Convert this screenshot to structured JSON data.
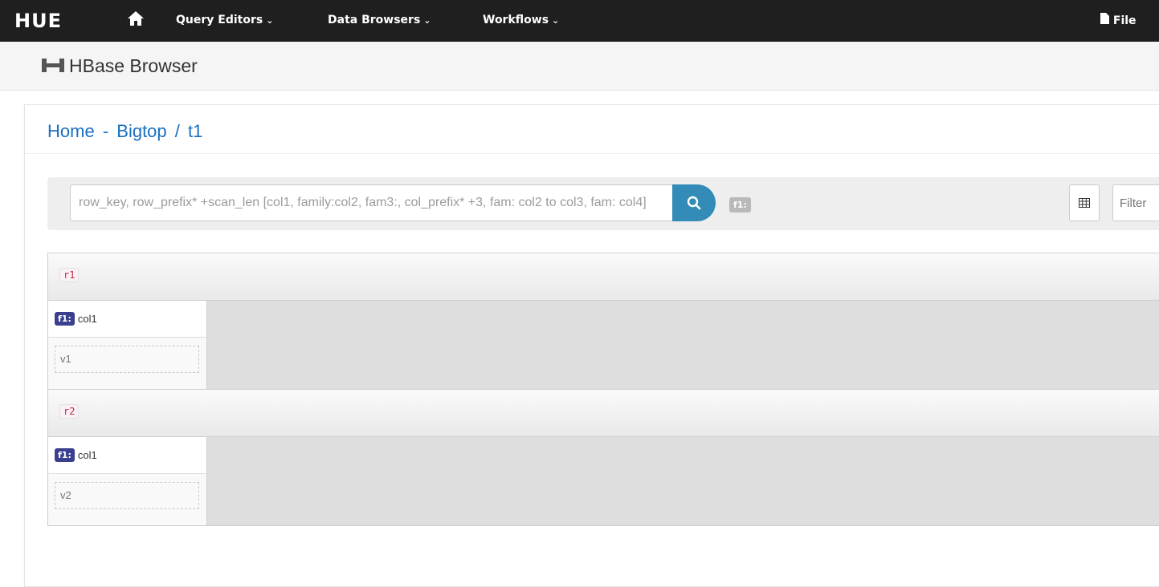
{
  "nav": {
    "logo": "HUE",
    "items": [
      {
        "label": "Query Editors"
      },
      {
        "label": "Data Browsers"
      },
      {
        "label": "Workflows"
      }
    ],
    "files_label": "File"
  },
  "app": {
    "title": "HBase Browser"
  },
  "breadcrumb": {
    "home": "Home",
    "separator": "-",
    "cluster": "Bigtop",
    "slash": "/",
    "table": "t1"
  },
  "search": {
    "placeholder": "row_key, row_prefix* +scan_len [col1, family:col2, fam3:, col_prefix* +3, fam: col2 to col3, fam: col4]",
    "family_tag": "f1:",
    "filter_placeholder": "Filter"
  },
  "rows": [
    {
      "key": "r1",
      "cells": [
        {
          "family": "f1:",
          "column": "col1",
          "value": "v1"
        }
      ]
    },
    {
      "key": "r2",
      "cells": [
        {
          "family": "f1:",
          "column": "col1",
          "value": "v2"
        }
      ]
    }
  ],
  "colors": {
    "navbar": "#1f1f1f",
    "link": "#1a6fc0",
    "search_button": "#338bb8",
    "family_badge": "#3b3f8f"
  }
}
